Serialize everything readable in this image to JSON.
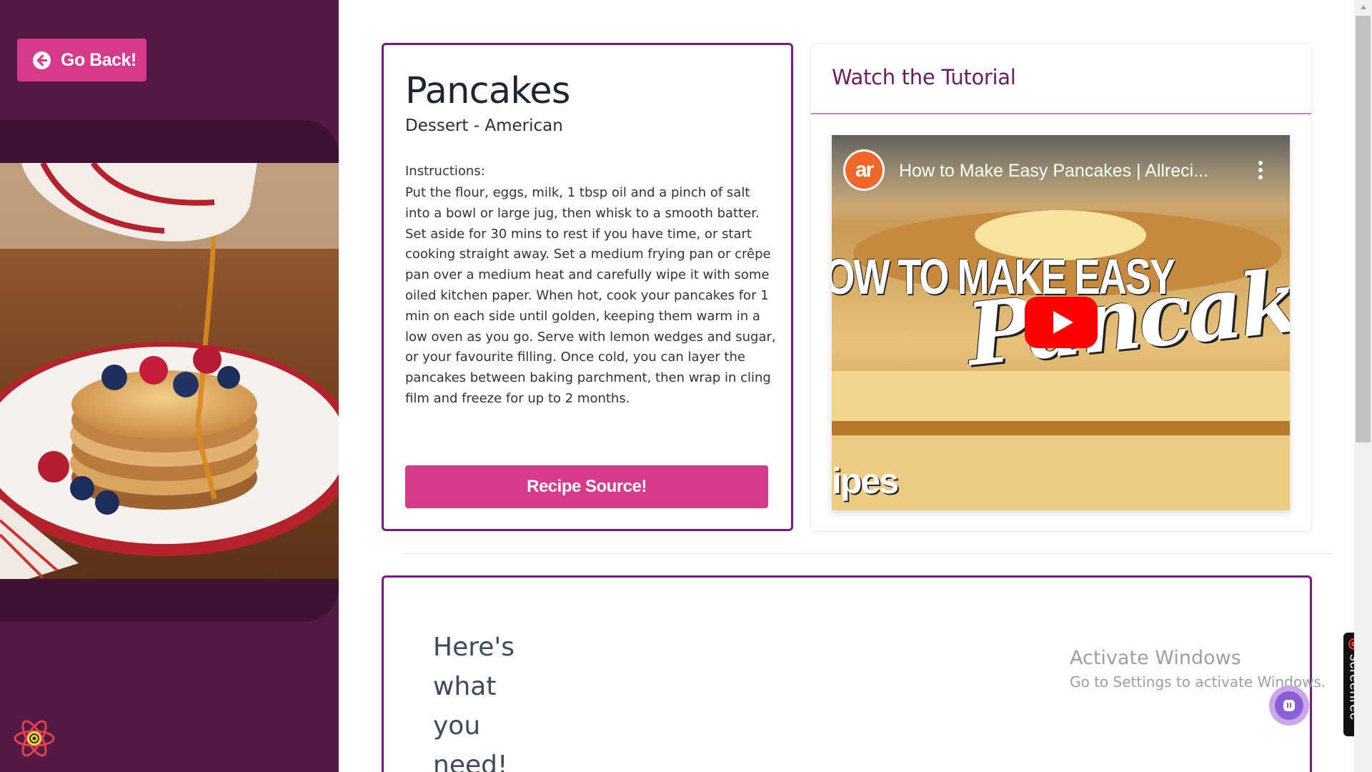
{
  "sidebar": {
    "back_label": "Go Back!",
    "image_alt": "Pancakes with berries and syrup"
  },
  "recipe": {
    "title": "Pancakes",
    "subtitle": "Dessert - American",
    "instructions_label": "Instructions:",
    "instructions": "Put the flour, eggs, milk, 1 tbsp oil and a pinch of salt into a bowl or large jug, then whisk to a smooth batter. Set aside for 30 mins to rest if you have time, or start cooking straight away. Set a medium frying pan or crêpe pan over a medium heat and carefully wipe it with some oiled kitchen paper. When hot, cook your pancakes for 1 min on each side until golden, keeping them warm in a low oven as you go. Serve with lemon wedges and sugar, or your favourite filling. Once cold, you can layer the pancakes between baking parchment, then wrap in cling film and freeze for up to 2 months.",
    "source_label": "Recipe Source!"
  },
  "tutorial": {
    "heading": "Watch the Tutorial",
    "video_title": "How to Make Easy Pancakes | Allreci...",
    "channel_logo_text": "ar",
    "thumb_line1": "OW TO MAKE EASY",
    "thumb_line2": "Pancakes",
    "thumb_line3": "ipes"
  },
  "needs": {
    "heading": "Here's what you need!"
  },
  "watermark": {
    "title": "Activate Windows",
    "subtitle": "Go to Settings to activate Windows."
  },
  "screenrec": {
    "label": "screenrec"
  },
  "colors": {
    "sidebar_bg": "#521a45",
    "accent_pink": "#d63a8a",
    "card_border": "#7a1783",
    "heading_purple": "#6b1d5f"
  },
  "icons": [
    "arrow-left-circle-icon",
    "react-logo-icon",
    "youtube-play-icon",
    "kebab-menu-icon",
    "chat-icon",
    "record-icon"
  ]
}
